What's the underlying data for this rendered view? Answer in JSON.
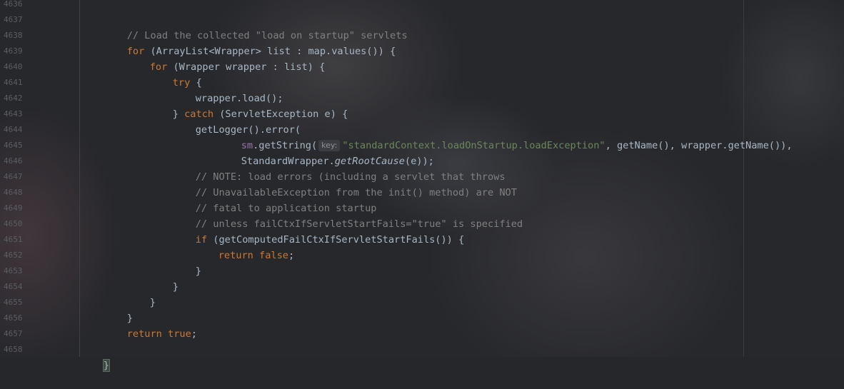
{
  "editor": {
    "line_numbers": [
      "4636",
      "4637",
      "4638",
      "4639",
      "4640",
      "4641",
      "4642",
      "4643",
      "4644",
      "4645",
      "4646",
      "4647",
      "4648",
      "4649",
      "4650",
      "4651",
      "4652",
      "4653",
      "4654",
      "4655",
      "4656",
      "4657",
      "4658"
    ],
    "param_hint": "key:",
    "lines": {
      "l4637": "// Load the collected \"load on startup\" servlets",
      "l4638_kw": "for",
      "l4638_text": " (ArrayList<Wrapper> list : map.values()) {",
      "l4639_kw": "for",
      "l4639_text": " (Wrapper wrapper : list) {",
      "l4640_kw": "try",
      "l4640_text": " {",
      "l4641": "wrapper.load();",
      "l4642_a": "} ",
      "l4642_kw": "catch",
      "l4642_b": " (ServletException e) {",
      "l4643": "getLogger().error(",
      "l4644_fld": "sm",
      "l4644_a": ".getString(",
      "l4644_str": "\"standardContext.loadOnStartup.loadException\"",
      "l4644_b": ", getName(), wrapper.getName()),",
      "l4645_a": "StandardWrapper.",
      "l4645_ital": "getRootCause",
      "l4645_b": "(e));",
      "l4646": "// NOTE: load errors (including a servlet that throws",
      "l4647": "// UnavailableException from the init() method) are NOT",
      "l4648": "// fatal to application startup",
      "l4649": "// unless failCtxIfServletStartFails=\"true\" is specified",
      "l4650_kw": "if",
      "l4650_text": " (getComputedFailCtxIfServletStartFails()) {",
      "l4651_kw1": "return",
      "l4651_sp": " ",
      "l4651_kw2": "false",
      "l4651_semi": ";",
      "l4652": "}",
      "l4653": "}",
      "l4654": "}",
      "l4655": "}",
      "l4656_kw1": "return",
      "l4656_sp": " ",
      "l4656_kw2": "true",
      "l4656_semi": ";",
      "l4658": "}"
    }
  },
  "colors": {
    "background": "#27282c",
    "keyword": "#cc7832",
    "comment": "#808080",
    "string": "#6a8759",
    "field": "#9876aa",
    "default_text": "#a9b7c6",
    "line_number": "#5a5d63"
  }
}
